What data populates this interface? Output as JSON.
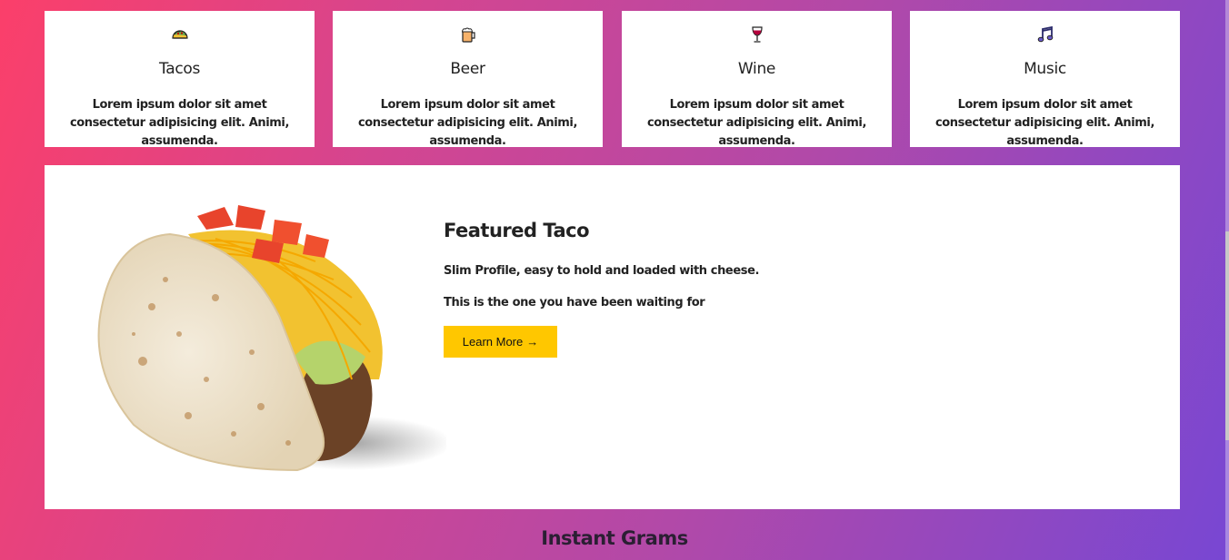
{
  "cards": [
    {
      "icon": "taco-icon",
      "title": "Tacos",
      "text": "Lorem ipsum dolor sit amet consectetur adipisicing elit. Animi, assumenda."
    },
    {
      "icon": "beer-mug-icon",
      "title": "Beer",
      "text": "Lorem ipsum dolor sit amet consectetur adipisicing elit. Animi, assumenda."
    },
    {
      "icon": "wine-glass-icon",
      "title": "Wine",
      "text": "Lorem ipsum dolor sit amet consectetur adipisicing elit. Animi, assumenda."
    },
    {
      "icon": "music-note-icon",
      "title": "Music",
      "text": "Lorem ipsum dolor sit amet consectetur adipisicing elit. Animi, assumenda."
    }
  ],
  "featured": {
    "image": "taco-image",
    "title": "Featured Taco",
    "line1": "Slim Profile, easy to hold and loaded with cheese.",
    "line2": "This is the one you have been waiting for",
    "button_label": "Learn More",
    "button_icon": "arrow-right-icon",
    "button_arrow": "→"
  },
  "section": {
    "title": "Instant Grams"
  },
  "colors": {
    "gradient_start": "#fb3f6a",
    "gradient_end": "#7847d3",
    "button": "#ffc700",
    "card_bg": "#ffffff"
  }
}
